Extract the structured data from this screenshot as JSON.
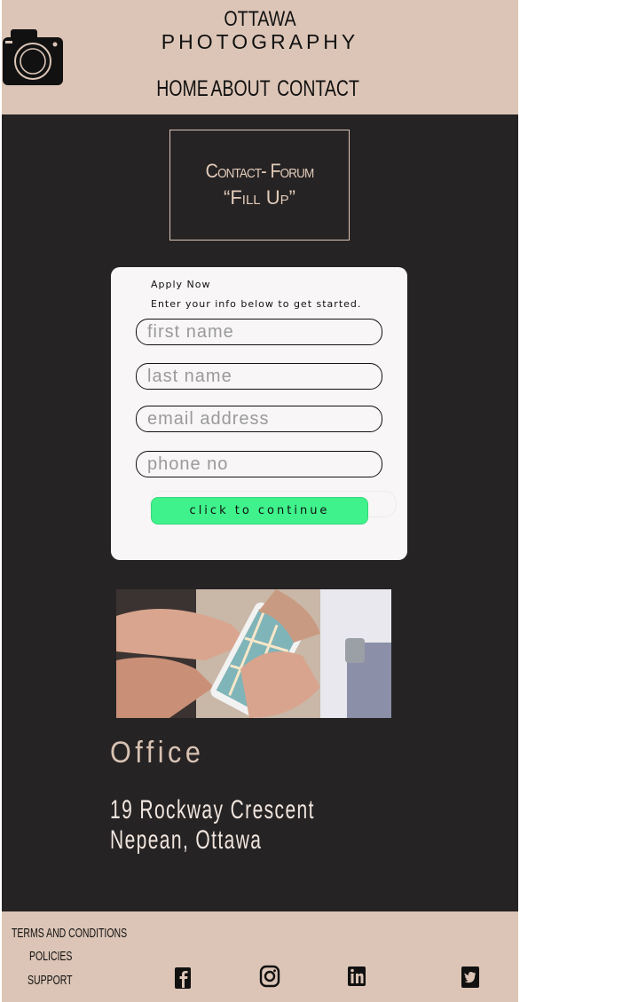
{
  "header": {
    "brand_line1": "OTTAWA",
    "brand_line2": "PHOTOGRAPHY",
    "nav": [
      "HOME",
      "ABOUT",
      "CONTACT"
    ]
  },
  "title": {
    "line1": "Contact- Forum",
    "line2": "“Fill   Up”"
  },
  "form": {
    "heading": "Apply Now",
    "subheading": "Enter your info below to get started.",
    "fields": {
      "first_name": "first name",
      "last_name": "last name",
      "email": "email address",
      "phone": "phone no"
    },
    "button": "click to continue",
    "button_color": "#3ff28b"
  },
  "office": {
    "heading": "Office",
    "address_line1": "19 Rockway Crescent",
    "address_line2": "Nepean, Ottawa"
  },
  "footer": {
    "links": [
      "TERMS AND CONDITIONS",
      "POLICIES",
      "SUPPORT"
    ],
    "social": [
      "facebook-icon",
      "instagram-icon",
      "linkedin-icon",
      "twitter-icon"
    ]
  },
  "colors": {
    "header_bg": "#dcc5b6",
    "main_bg": "#262324",
    "accent_text": "#e2cbb9"
  }
}
